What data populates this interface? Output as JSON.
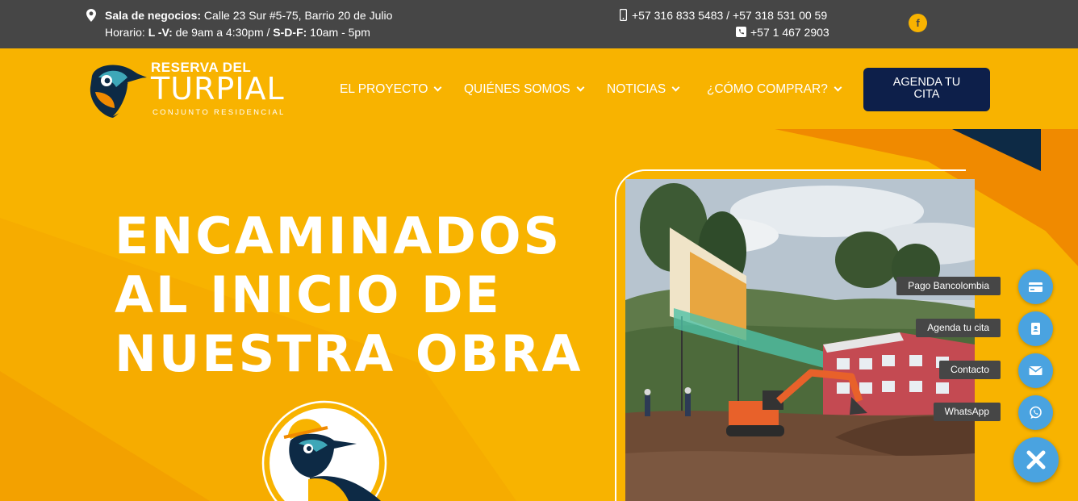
{
  "topbar": {
    "sales_label": "Sala de negocios:",
    "sales_address": " Calle 23 Sur #5-75, Barrio 20 de Julio",
    "hours_prefix": "Horario: ",
    "weekday_label": "L -V:",
    "weekday_hours": " de 9am a 4:30pm / ",
    "weekend_label": "S-D-F:",
    "weekend_hours": " 10am - 5pm",
    "mobile_phones": "+57 316 833 5483 / +57 318 531 00 59",
    "landline_phone": "+57 1 467 2903",
    "social_icon": "facebook-icon",
    "facebook_glyph": "f"
  },
  "logo": {
    "line1": "RESERVA DEL",
    "line2": "TURPIAL",
    "line3": "CONJUNTO RESIDENCIAL"
  },
  "nav": {
    "items": [
      {
        "label": "EL PROYECTO"
      },
      {
        "label": "QUIÉNES SOMOS"
      },
      {
        "label": "NOTICIAS"
      },
      {
        "label": "¿CÓMO COMPRAR?"
      }
    ],
    "cta_line1": "AGENDA TU",
    "cta_line2": "CITA"
  },
  "hero": {
    "headline_lines": [
      "ENCAMINADOS",
      "AL INICIO DE",
      "NUESTRA OBRA"
    ]
  },
  "floating": {
    "items": [
      {
        "label": "Pago Bancolombia",
        "icon": "credit-card-icon"
      },
      {
        "label": "Agenda tu cita",
        "icon": "address-book-icon"
      },
      {
        "label": "Contacto",
        "icon": "envelope-icon"
      },
      {
        "label": "WhatsApp",
        "icon": "whatsapp-icon"
      }
    ],
    "close_icon": "close-icon"
  },
  "colors": {
    "brand_yellow": "#f8b300",
    "brand_orange": "#f08a00",
    "navy": "#0d1f4a",
    "topbar_gray": "#464646",
    "accent_blue": "#4aa3e0"
  }
}
